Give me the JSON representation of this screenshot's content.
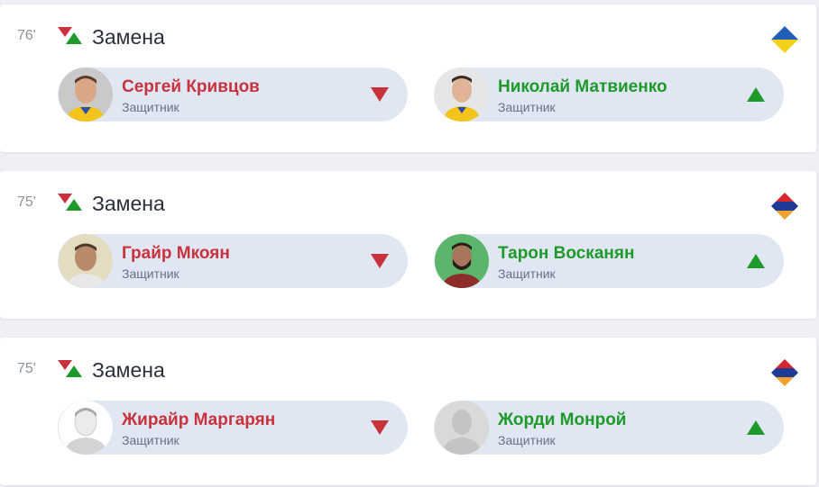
{
  "event_label": "Замена",
  "colors": {
    "out": "#c8323c",
    "in": "#1d9a2a",
    "pill_bg": "#e1e6f3"
  },
  "events": [
    {
      "minute": "76'",
      "team_flag": "ukraine-flag-icon",
      "player_out": {
        "name": "Сергей Кривцов",
        "role": "Защитник"
      },
      "player_in": {
        "name": "Николай Матвиенко",
        "role": "Защитник"
      }
    },
    {
      "minute": "75'",
      "team_flag": "armenia-flag-icon",
      "player_out": {
        "name": "Грайр Мкоян",
        "role": "Защитник"
      },
      "player_in": {
        "name": "Тарон Восканян",
        "role": "Защитник"
      }
    },
    {
      "minute": "75'",
      "team_flag": "armenia-flag-icon",
      "player_out": {
        "name": "Жирайр Маргарян",
        "role": "Защитник"
      },
      "player_in": {
        "name": "Жорди Монрой",
        "role": "Защитник"
      }
    }
  ]
}
